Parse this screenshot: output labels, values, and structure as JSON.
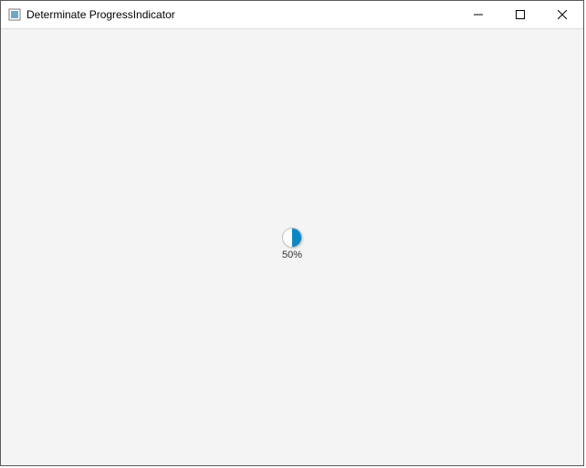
{
  "window": {
    "title": "Determinate ProgressIndicator"
  },
  "progress": {
    "percent": 50,
    "label": "50%",
    "fill_color": "#0d86c4",
    "track_color": "#fcfcfc"
  }
}
